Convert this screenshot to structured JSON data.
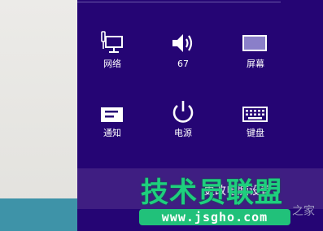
{
  "quick_settings": [
    {
      "label": "网络",
      "icon": "network-icon"
    },
    {
      "label": "67",
      "icon": "volume-icon"
    },
    {
      "label": "屏幕",
      "icon": "screen-icon"
    },
    {
      "label": "通知",
      "icon": "notifications-icon"
    },
    {
      "label": "电源",
      "icon": "power-icon"
    },
    {
      "label": "键盘",
      "icon": "keyboard-icon"
    }
  ],
  "more_settings": {
    "label": "更改电脑设置"
  },
  "watermark": {
    "title": "技术员联盟",
    "url": "www.jsgho.com",
    "tail": "之家"
  },
  "colors": {
    "panel": "#250574",
    "more_settings_band": "#3f1e82",
    "watermark_green": "#21c17a"
  }
}
